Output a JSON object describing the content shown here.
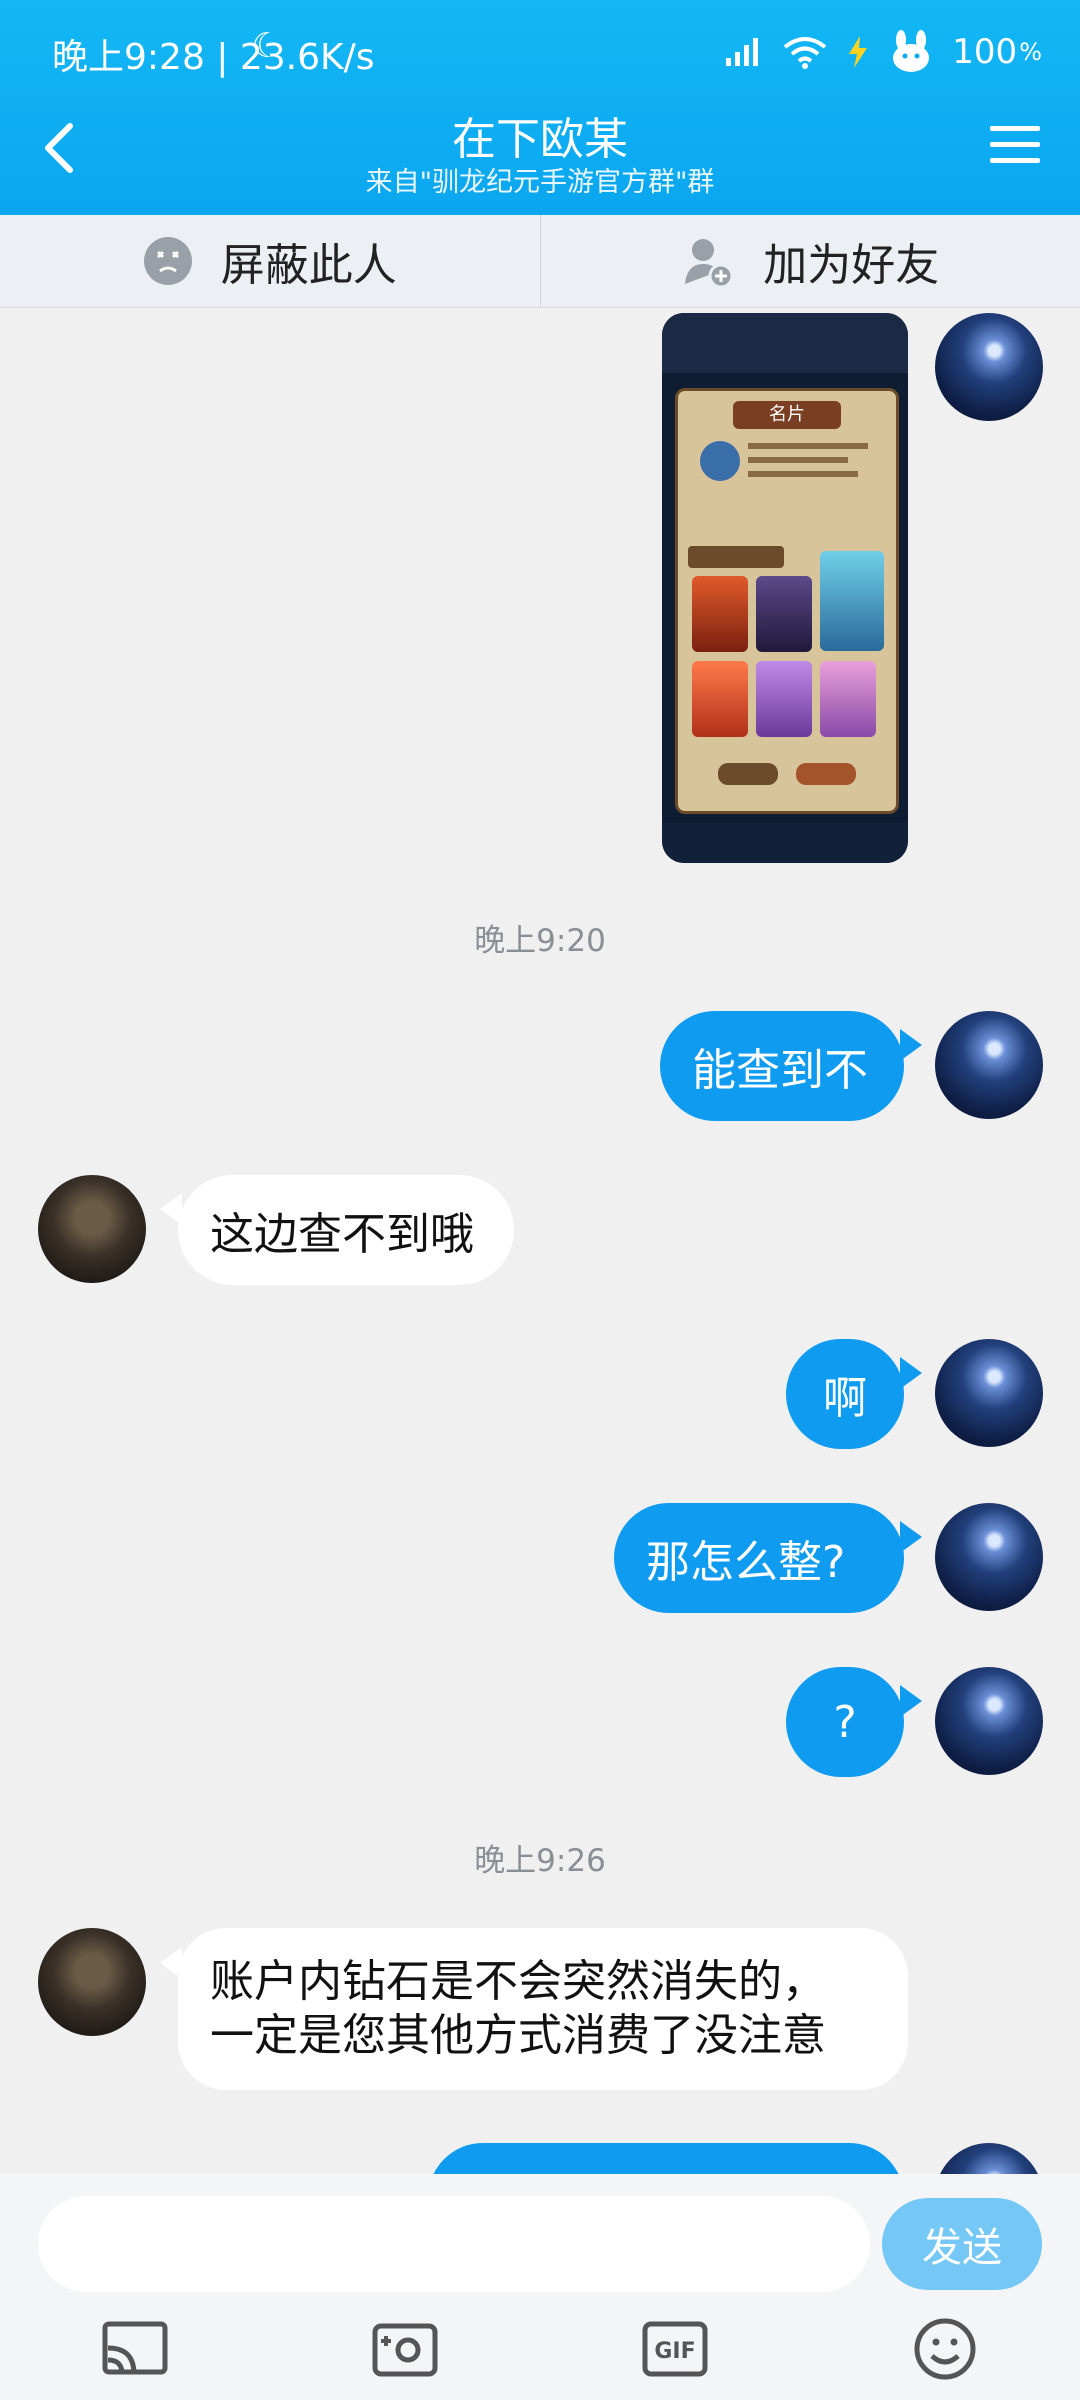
{
  "status_bar": {
    "left_text": "晚上9:28 | 23.6K/s",
    "battery": "100"
  },
  "header": {
    "title": "在下欧某",
    "subtitle": "来自\"驯龙纪元手游官方群\"群"
  },
  "actions": {
    "block_label": "屏蔽此人",
    "add_friend_label": "加为好友"
  },
  "image_message": {
    "card_title": "名片"
  },
  "messages": [
    {
      "type": "time",
      "text": "晚上9:20"
    },
    {
      "type": "sent",
      "text": "能查到不"
    },
    {
      "type": "received",
      "text": "这边查不到哦"
    },
    {
      "type": "sent",
      "text": "啊"
    },
    {
      "type": "sent",
      "text": "那怎么整?"
    },
    {
      "type": "sent",
      "text": "?"
    },
    {
      "type": "time",
      "text": "晚上9:26"
    },
    {
      "type": "received",
      "text": "账户内钻石是不会突然消失的，\n一定是您其他方式消费了没注意"
    }
  ],
  "input": {
    "placeholder": "",
    "send_label": "发送"
  },
  "toolbar": {
    "icons": [
      "screen-cast-icon",
      "camera-icon",
      "gif-icon",
      "emoji-icon"
    ]
  },
  "colors": {
    "header": "#0aa6f0",
    "sent_bubble": "#0f9bf0",
    "received_bubble": "#ffffff",
    "send_button": "#75c8f5"
  }
}
